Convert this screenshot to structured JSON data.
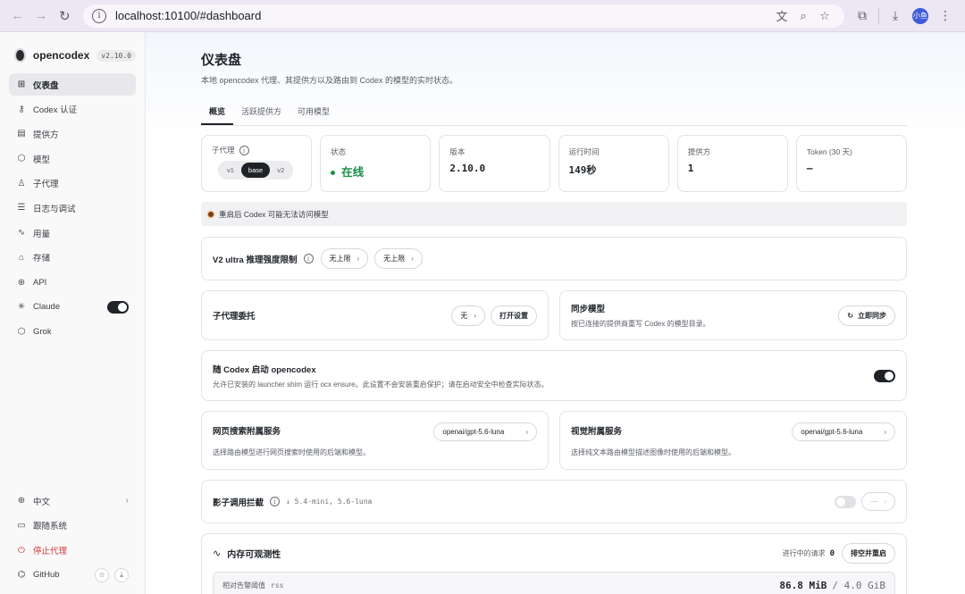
{
  "browser": {
    "url": "localhost:10100/#dashboard",
    "avatar_text": "小鱼"
  },
  "sidebar": {
    "brand": "opencodex",
    "version": "v2.10.0",
    "items": [
      {
        "label": "仪表盘",
        "icon": "grid-icon",
        "glyph": "⊞"
      },
      {
        "label": "Codex 认证",
        "icon": "key-icon",
        "glyph": "⚷"
      },
      {
        "label": "提供方",
        "icon": "server-icon",
        "glyph": "▤"
      },
      {
        "label": "模型",
        "icon": "cube-icon",
        "glyph": "⬡"
      },
      {
        "label": "子代理",
        "icon": "robot-icon",
        "glyph": "♙"
      },
      {
        "label": "日志与调试",
        "icon": "list-icon",
        "glyph": "☰"
      },
      {
        "label": "用量",
        "icon": "activity-icon",
        "glyph": "∿"
      },
      {
        "label": "存储",
        "icon": "drive-icon",
        "glyph": "⌂"
      },
      {
        "label": "API",
        "icon": "globe-icon",
        "glyph": "⊕"
      },
      {
        "label": "Claude",
        "icon": "sparkle-icon",
        "glyph": "✳"
      },
      {
        "label": "Grok",
        "icon": "cube-icon",
        "glyph": "⬡"
      }
    ],
    "bottom": {
      "language": "中文",
      "follow_system": "跟随系统",
      "stop_proxy": "停止代理",
      "github": "GitHub"
    }
  },
  "page": {
    "title": "仪表盘",
    "subtitle": "本地 opencodex 代理、其提供方以及路由到 Codex 的模型的实时状态。",
    "tabs": [
      "概览",
      "活跃提供方",
      "可用模型"
    ]
  },
  "stats": {
    "subagent_label": "子代理",
    "subagent_options": [
      "v1",
      "base",
      "v2"
    ],
    "status_label": "状态",
    "status_value": "在线",
    "version_label": "版本",
    "version_value": "2.10.0",
    "uptime_label": "运行时间",
    "uptime_value": "149秒",
    "providers_label": "提供方",
    "providers_value": "1",
    "token_label": "Token (30 天)",
    "token_value": "—"
  },
  "warning": "重启后 Codex 可能无法访问模型",
  "v2ultra": {
    "title": "V2 ultra 推理强度限制",
    "pill1": "无上限",
    "pill2": "无上限"
  },
  "delegation": {
    "title": "子代理委托",
    "value": "无",
    "open_settings": "打开设置"
  },
  "sync": {
    "title": "同步模型",
    "desc": "按已连接的提供商重写 Codex 的模型目录。",
    "button": "立即同步"
  },
  "launch": {
    "title": "随 Codex 启动 opencodex",
    "desc": "允许已安装的 launcher shim 运行 ocx ensure。此设置不会安装重启保护；请在启动安全中检查实际状态。"
  },
  "web_search": {
    "title": "网页搜索附属服务",
    "desc": "选择路由模型进行网页搜索时使用的后端和模型。",
    "model": "openai/gpt-5.6-luna"
  },
  "vision": {
    "title": "视觉附属服务",
    "desc": "选择纯文本路由模型描述图像时使用的后端和模型。",
    "model": "openai/gpt-5.6-luna"
  },
  "shadow": {
    "title": "影子调用拦截",
    "detail": "↓ 5.4-mini, 5.6-luna",
    "pill": "—"
  },
  "memory": {
    "title": "内存可观测性",
    "inflight_label": "进行中的请求",
    "inflight_value": "0",
    "drain_button": "排空并重启",
    "threshold_label": "相对告警阈值",
    "threshold_metric": "rss",
    "used": "86.8 MiB",
    "total": "/ 4.0 GiB",
    "fraction": 0.021
  }
}
